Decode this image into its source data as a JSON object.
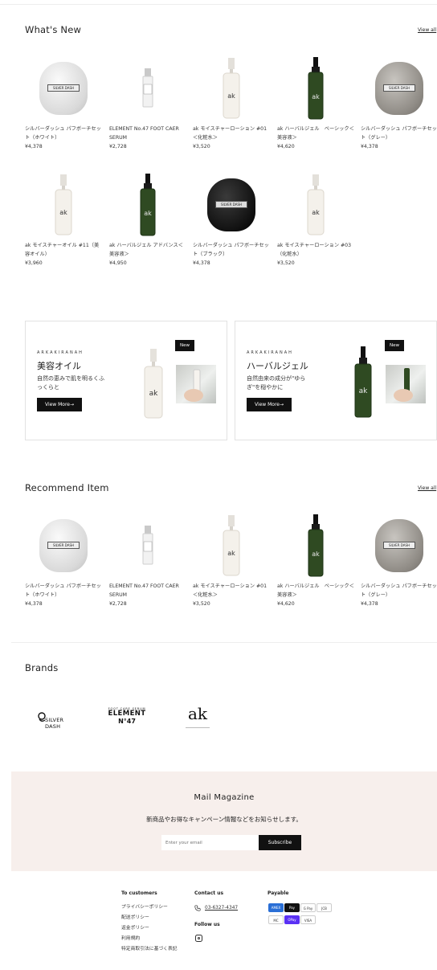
{
  "whats_new": {
    "title": "What's New",
    "view_all": "View all",
    "products": [
      {
        "name": "シルバーダッシュ パフボーチセット（ホワイト）",
        "price": "¥4,378",
        "img": "pouch-white"
      },
      {
        "name": "ELEMENT No.47 FOOT CAER SERUM",
        "price": "¥2,728",
        "img": "serum"
      },
      {
        "name": "ak モイスチャーローション #01＜化粧水＞",
        "price": "¥3,520",
        "img": "white-bottle"
      },
      {
        "name": "ak ハーバルジェル　ベーシック＜美容液＞",
        "price": "¥4,620",
        "img": "green-bottle"
      },
      {
        "name": "シルバーダッシュ パフボーチセット（グレー）",
        "price": "¥4,378",
        "img": "pouch-grey"
      },
      {
        "name": "ak モイスチャーオイル #11（美容オイル）",
        "price": "¥3,960",
        "img": "white-bottle"
      },
      {
        "name": "ak ハーバルジェル アドバンス＜美容液＞",
        "price": "¥4,950",
        "img": "green-bottle"
      },
      {
        "name": "シルバーダッシュ パフボーチセット（ブラック）",
        "price": "¥4,378",
        "img": "pouch-black"
      },
      {
        "name": "ak モイスチャーローション #03（化粧水）",
        "price": "¥3,520",
        "img": "white-bottle"
      }
    ]
  },
  "banners": [
    {
      "brand": "ARKAKIRANAH",
      "title": "美容オイル",
      "desc": "自然の恵みで肌を明るくふっくらと",
      "button": "View More→",
      "tag": "New"
    },
    {
      "brand": "ARKAKIRANAH",
      "title": "ハーバルジェル",
      "desc": "自然由来の成分が\"ゆらぎ\"を穏やかに",
      "button": "View More→",
      "tag": "New"
    }
  ],
  "recommend": {
    "title": "Recommend Item",
    "view_all": "View all",
    "products": [
      {
        "name": "シルバーダッシュ パフボーチセット（ホワイト）",
        "price": "¥4,378",
        "img": "pouch-white"
      },
      {
        "name": "ELEMENT No.47 FOOT CAER SERUM",
        "price": "¥2,728",
        "img": "serum"
      },
      {
        "name": "ak モイスチャーローション #01＜化粧水＞",
        "price": "¥3,520",
        "img": "white-bottle"
      },
      {
        "name": "ak ハーバルジェル　ベーシック＜美容液＞",
        "price": "¥4,620",
        "img": "green-bottle"
      },
      {
        "name": "シルバーダッシュ パフボーチセット（グレー）",
        "price": "¥4,378",
        "img": "pouch-grey"
      }
    ]
  },
  "brands": {
    "title": "Brands",
    "logos": [
      {
        "text": "SILVER DASH"
      },
      {
        "top": "FOOT CARE SERUM",
        "text": "ELEMENT",
        "sub": "N°47"
      },
      {
        "text": "ak"
      }
    ]
  },
  "mail": {
    "title": "Mail Magazine",
    "desc": "新商品やお得なキャンペーン情報などをお知らせします。",
    "placeholder": "Enter your email",
    "button": "Subscribe"
  },
  "footer": {
    "customers_title": "To customers",
    "customers_links": [
      "プライバシーポリシー",
      "配送ポリシー",
      "返金ポリシー",
      "利用規約",
      "特定商取引法に基づく表記"
    ],
    "contact_title": "Contact us",
    "phone": "03-6327-4347",
    "follow_title": "Follow us",
    "payable_title": "Payable",
    "payments": [
      {
        "label": "AMEX",
        "color": "#2a6fd6"
      },
      {
        "label": "Pay",
        "color": "#111111"
      },
      {
        "label": "G Pay",
        "color": "#ffffff"
      },
      {
        "label": "JCB",
        "color": "#ffffff"
      },
      {
        "label": "MC",
        "color": "#ffffff"
      },
      {
        "label": "OPay",
        "color": "#5a31f4"
      },
      {
        "label": "VISA",
        "color": "#ffffff"
      }
    ]
  }
}
